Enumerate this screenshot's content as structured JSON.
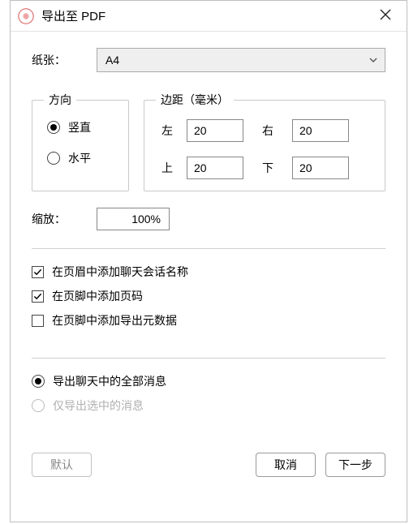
{
  "title": "导出至 PDF",
  "paper": {
    "label": "纸张：",
    "value": "A4"
  },
  "orientation": {
    "legend": "方向",
    "vertical": "竖直",
    "horizontal": "水平",
    "selected": "vertical"
  },
  "margins": {
    "legend": "边距（毫米）",
    "left": {
      "label": "左",
      "value": "20"
    },
    "right": {
      "label": "右",
      "value": "20"
    },
    "top": {
      "label": "上",
      "value": "20"
    },
    "bottom": {
      "label": "下",
      "value": "20"
    }
  },
  "zoom": {
    "label": "缩放：",
    "value": "100%"
  },
  "options": {
    "header_name": {
      "label": "在页眉中添加聊天会话名称",
      "checked": true
    },
    "footer_page": {
      "label": "在页脚中添加页码",
      "checked": true
    },
    "footer_meta": {
      "label": "在页脚中添加导出元数据",
      "checked": false
    }
  },
  "scope": {
    "all": {
      "label": "导出聊天中的全部消息",
      "selected": true,
      "enabled": true
    },
    "selected": {
      "label": "仅导出选中的消息",
      "selected": false,
      "enabled": false
    }
  },
  "buttons": {
    "default": "默认",
    "cancel": "取消",
    "next": "下一步"
  },
  "bg": {
    "b1": "",
    "b2": ""
  }
}
